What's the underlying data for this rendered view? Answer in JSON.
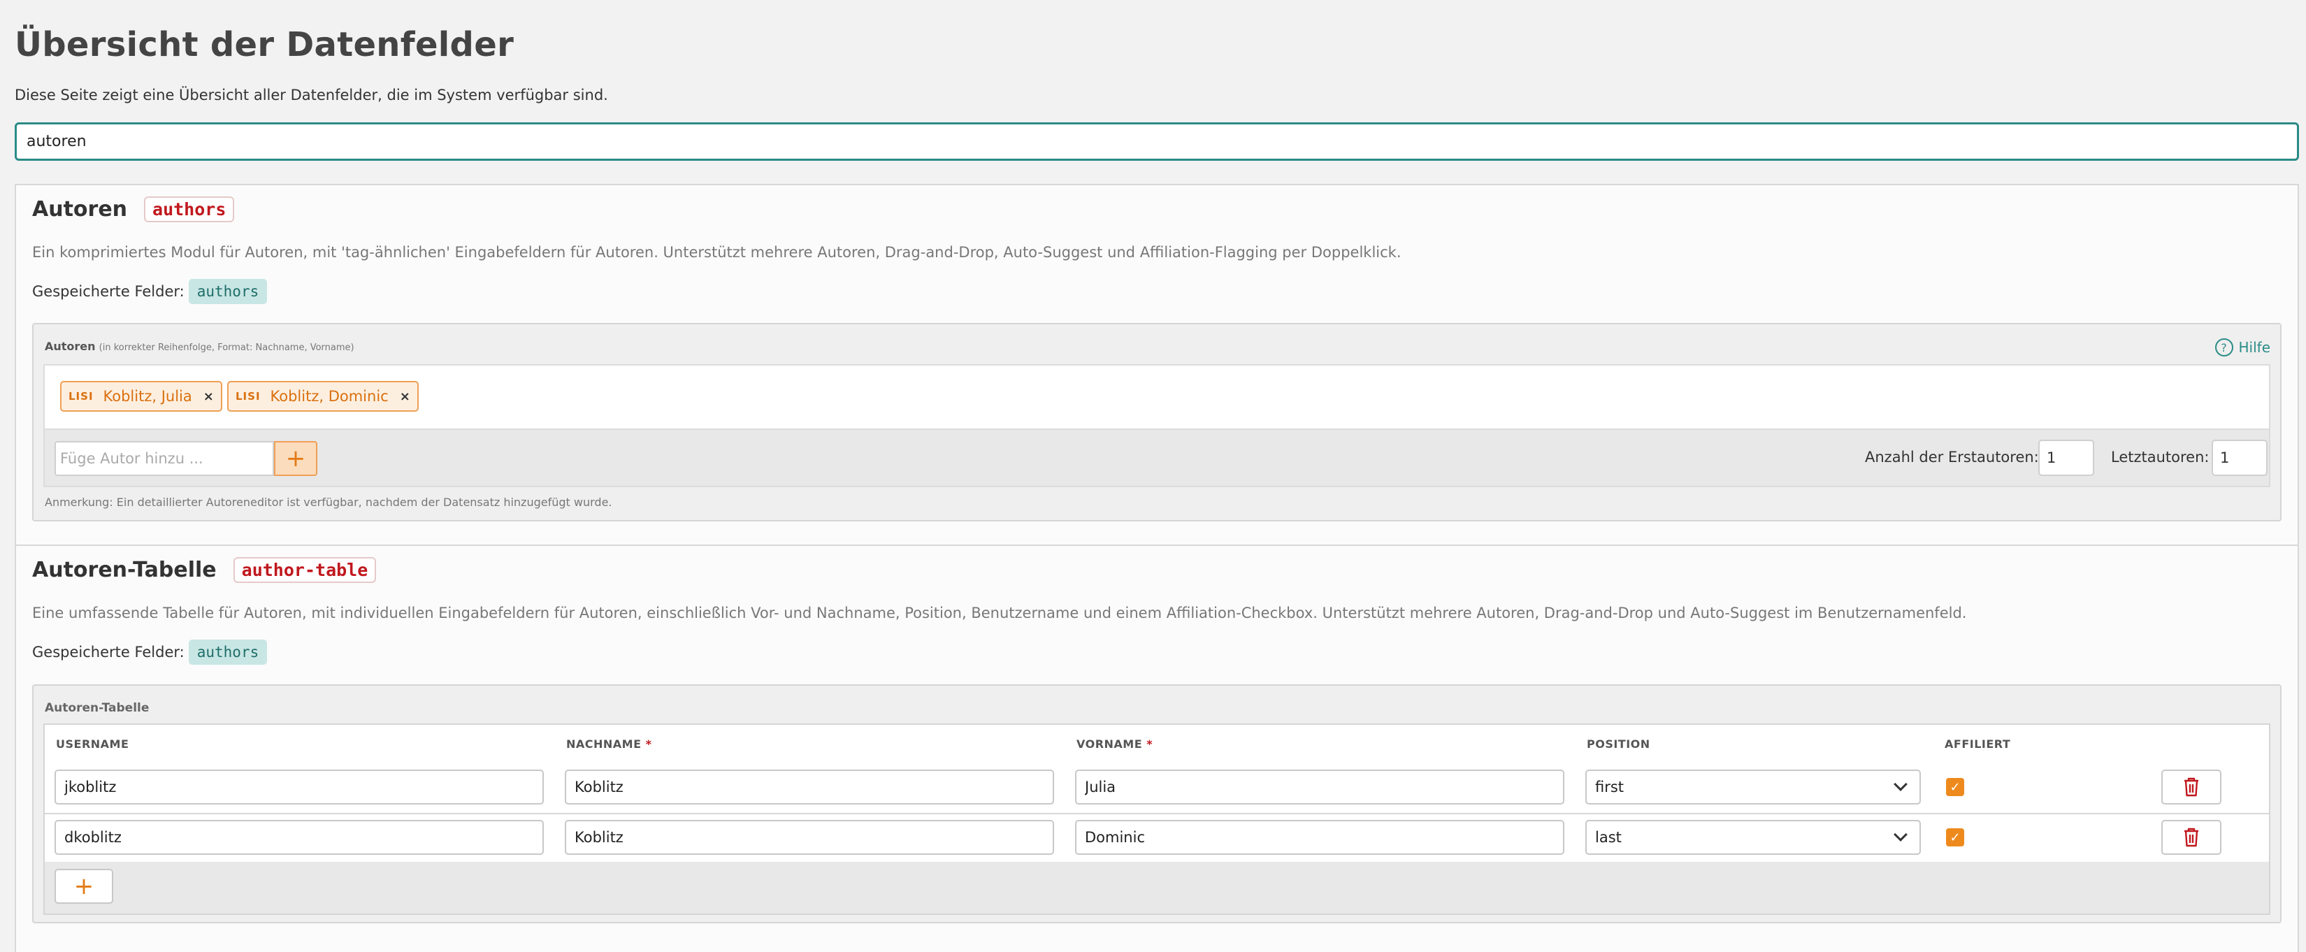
{
  "page": {
    "title": "Übersicht der Datenfelder",
    "description": "Diese Seite zeigt eine Übersicht aller Datenfelder, die im System verfügbar sind."
  },
  "search": {
    "value": "autoren"
  },
  "sections": [
    {
      "title": "Autoren",
      "code": "authors",
      "description": "Ein komprimiertes Modul für Autoren, mit 'tag-ähnlichen' Eingabefeldern für Autoren. Unterstützt mehrere Autoren, Drag-and-Drop, Auto-Suggest und Affiliation-Flagging per Doppelklick.",
      "saved_label": "Gespeicherte Felder:",
      "saved_field": "authors",
      "widget": {
        "label": "Autoren",
        "label_hint": "(in korrekter Reihenfolge, Format: Nachname, Vorname)",
        "help_label": "Hilfe",
        "help_icon": "?",
        "chips": [
          {
            "badge": "LISI",
            "name": "Koblitz, Julia",
            "remove": "×"
          },
          {
            "badge": "LISI",
            "name": "Koblitz, Dominic",
            "remove": "×"
          }
        ],
        "add_placeholder": "Füge Autor hinzu ...",
        "add_icon": "+",
        "first_authors_label": "Anzahl der Erstautoren:",
        "first_authors_value": "1",
        "last_authors_label": "Letztautoren:",
        "last_authors_value": "1",
        "note": "Anmerkung: Ein detaillierter Autoreneditor ist verfügbar, nachdem der Datensatz hinzugefügt wurde."
      }
    },
    {
      "title": "Autoren-Tabelle",
      "code": "author-table",
      "description": "Eine umfassende Tabelle für Autoren, mit individuellen Eingabefeldern für Autoren, einschließlich Vor- und Nachname, Position, Benutzername und einem Affiliation-Checkbox. Unterstützt mehrere Autoren, Drag-and-Drop und Auto-Suggest im Benutzernamenfeld.",
      "saved_label": "Gespeicherte Felder:",
      "saved_field": "authors",
      "table": {
        "label": "Autoren-Tabelle",
        "headers": {
          "username": "USERNAME",
          "lastname": "NACHNAME",
          "firstname": "VORNAME",
          "position": "POSITION",
          "affiliated": "AFFILIERT",
          "required_mark": "*"
        },
        "rows": [
          {
            "username": "jkoblitz",
            "lastname": "Koblitz",
            "firstname": "Julia",
            "position": "first",
            "affiliated": true
          },
          {
            "username": "dkoblitz",
            "lastname": "Koblitz",
            "firstname": "Dominic",
            "position": "last",
            "affiliated": true
          }
        ],
        "check_icon": "✓",
        "add_icon": "+"
      }
    }
  ],
  "colors": {
    "accent": "#2a8c87",
    "orange": "#ee8a1d",
    "code_red": "#c0181e",
    "delete_red": "#c0181e"
  }
}
